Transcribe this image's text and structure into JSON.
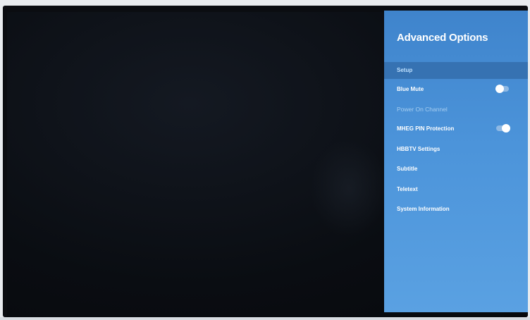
{
  "panel": {
    "title": "Advanced Options",
    "section": "Setup",
    "items": [
      {
        "label": "Blue Mute",
        "toggle": "off"
      },
      {
        "label": "Power On Channel",
        "state": "disabled"
      },
      {
        "label": "MHEG PIN Protection",
        "toggle": "on"
      },
      {
        "label": "HBBTV Settings"
      },
      {
        "label": "Subtitle"
      },
      {
        "label": "Teletext"
      },
      {
        "label": "System Information"
      }
    ]
  },
  "colors": {
    "panel_blue": "#4c94da",
    "section_blue": "#3672b2",
    "screen_black": "#0a0d12"
  }
}
